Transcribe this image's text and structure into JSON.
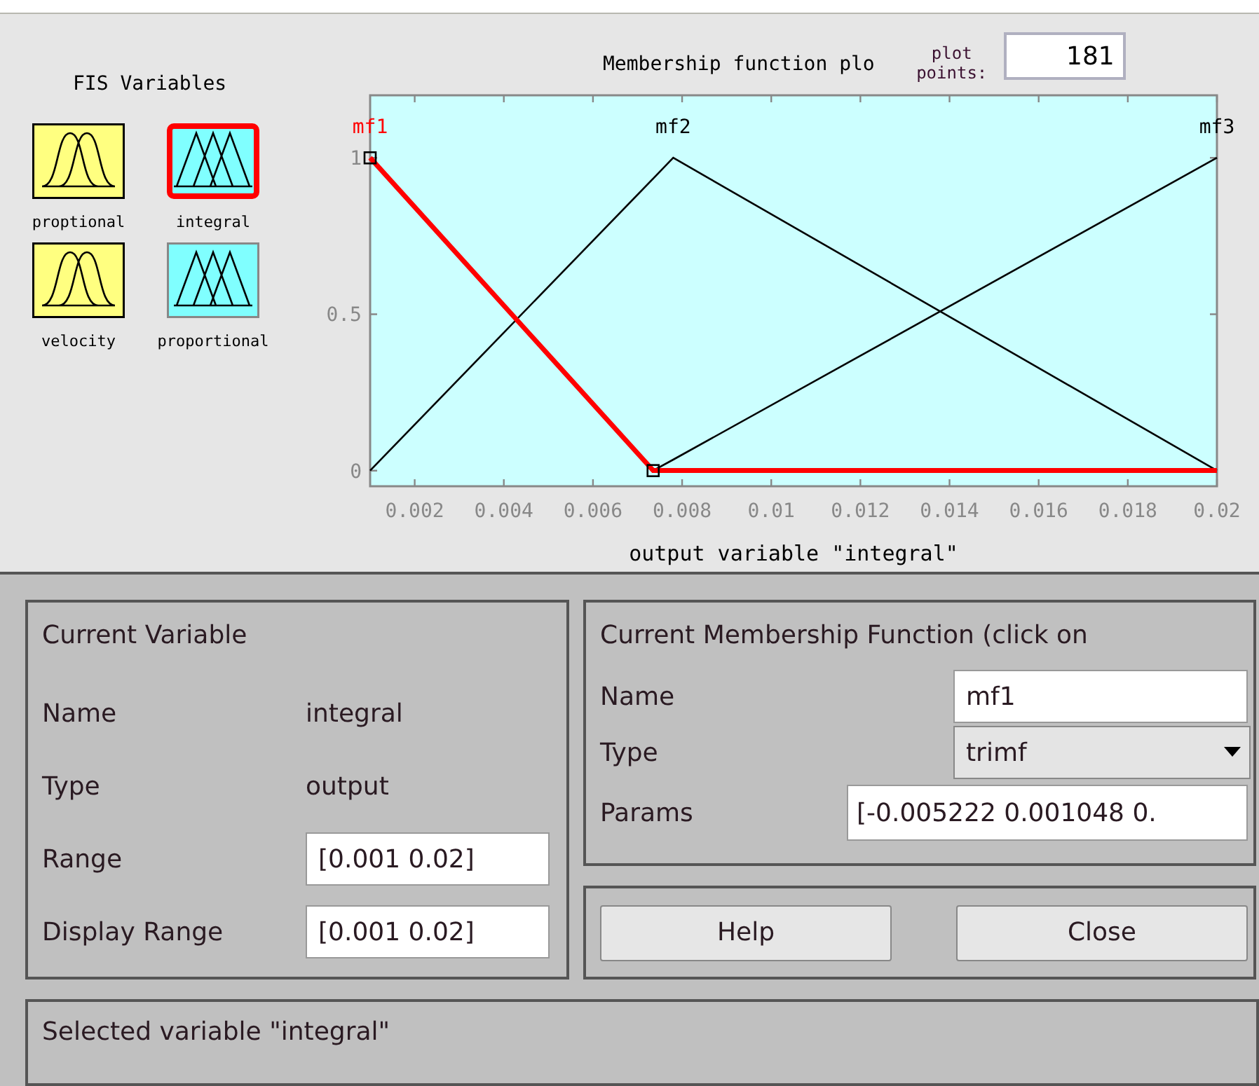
{
  "fis_variables": {
    "title": "FIS Variables",
    "items": [
      {
        "label": "proptional",
        "kind": "input",
        "selected": false
      },
      {
        "label": "integral",
        "kind": "output",
        "selected": true
      },
      {
        "label": "velocity",
        "kind": "input",
        "selected": false
      },
      {
        "label": "proportional",
        "kind": "output",
        "selected": false
      }
    ]
  },
  "plot": {
    "title": "Membership function plo",
    "points_label": "plot points:",
    "points": "181",
    "chart_data": {
      "type": "line",
      "xlabel": "output variable \"integral\"",
      "x": [
        0.001,
        0.00735,
        0.0078,
        0.02
      ],
      "xlim": [
        0.001,
        0.02
      ],
      "ylim": [
        -0.05,
        1.2
      ],
      "xticks": [
        0.002,
        0.004,
        0.006,
        0.008,
        0.01,
        0.012,
        0.014,
        0.016,
        0.018,
        0.02
      ],
      "yticks": [
        0,
        0.5,
        1
      ],
      "series": [
        {
          "name": "mf3",
          "color": "#000000",
          "values": [
            null,
            0,
            0.035,
            1
          ]
        },
        {
          "name": "mf2",
          "color": "#000000",
          "values": [
            0,
            0.934,
            1,
            0
          ]
        },
        {
          "name": "mf1",
          "color": "#ff0000",
          "values": [
            1,
            0,
            0,
            0
          ]
        }
      ]
    },
    "membership_functions": [
      {
        "selected": false
      },
      {
        "selected": false
      },
      {
        "selected": true
      }
    ]
  },
  "current_variable": {
    "title": "Current Variable",
    "rows": [
      {
        "label": "Name",
        "kind": "text",
        "value": "integral"
      },
      {
        "label": "Type",
        "kind": "text",
        "value": "output"
      },
      {
        "label": "Range",
        "kind": "field",
        "value": "[0.001 0.02]"
      },
      {
        "label": "Display Range",
        "kind": "field",
        "value": "[0.001 0.02]"
      }
    ]
  },
  "current_mf": {
    "title": "Current Membership Function (click on",
    "name_label": "Name",
    "name": "mf1",
    "type_label": "Type",
    "type": "trimf",
    "params_label": "Params",
    "params": "[-0.005222 0.001048 0."
  },
  "buttons": [
    "Help",
    "Close"
  ],
  "status": "Selected variable \"integral\""
}
